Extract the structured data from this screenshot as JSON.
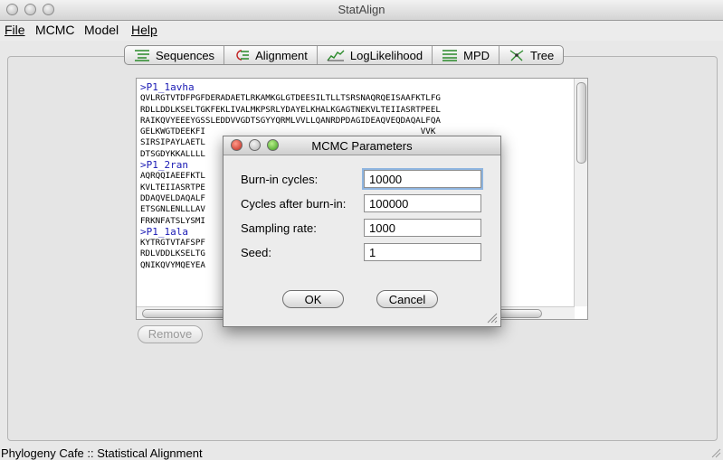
{
  "window": {
    "title": "StatAlign"
  },
  "menu": {
    "file": "File",
    "mcmc": "MCMC",
    "model": "Model",
    "help": "Help"
  },
  "tabs": {
    "sequences": "Sequences",
    "alignment": "Alignment",
    "loglikelihood": "LogLikelihood",
    "mpd": "MPD",
    "tree": "Tree"
  },
  "sequences": {
    "lines": [
      {
        "name": true,
        "text": ">P1_1avha"
      },
      {
        "name": false,
        "text": "QVLRGTVTDFPGFDERADAETLRKAMKGLGTDEESILTLLTSRSNAQRQEISAAFKTLFG"
      },
      {
        "name": false,
        "text": "RDLLDDLKSELTGKFEKLIVALMKPSRLYDAYELKHALKGAGTNEKVLTEIIASRTPEEL"
      },
      {
        "name": false,
        "text": "RAIKQVYEEEYGSSLEDDVVGDTSGYYQRMLVVLLQANRDPDAGIDEAQVEQDAQALFQA"
      },
      {
        "name": false,
        "text": "GELKWGTDEEKFI                                           VVK"
      },
      {
        "name": false,
        "text": "SIRSIPAYLAETL                                           HIKG"
      },
      {
        "name": false,
        "text": "DTSGDYKKALLLL"
      },
      {
        "name": true,
        "text": ">P1_2ran"
      },
      {
        "name": false,
        "text": "AQRQQIAEEFKTL                                           TDE"
      },
      {
        "name": false,
        "text": "KVLTEIIASRTPE                                           TAI"
      },
      {
        "name": false,
        "text": "DDAQVELDAQALF                                           IDR"
      },
      {
        "name": false,
        "text": "ETSGNLENLLLAV                                           RKE"
      },
      {
        "name": false,
        "text": "FRKNFATSLYSMI"
      },
      {
        "name": true,
        "text": ">P1_1ala"
      },
      {
        "name": false,
        "text": "KYTRGTVTAFSPF                                           LFG"
      },
      {
        "name": false,
        "text": "RDLVDDLKSELTG                                           AEV"
      },
      {
        "name": false,
        "text": "QNIKQVYMQEYEA                                           FRA"
      }
    ]
  },
  "remove_button": "Remove",
  "status_bar": "Phylogeny Cafe :: Statistical Alignment",
  "dialog": {
    "title": "MCMC Parameters",
    "fields": [
      {
        "label": "Burn-in cycles:",
        "value": "10000"
      },
      {
        "label": "Cycles after burn-in:",
        "value": "100000"
      },
      {
        "label": "Sampling rate:",
        "value": "1000"
      },
      {
        "label": "Seed:",
        "value": "1"
      }
    ],
    "ok": "OK",
    "cancel": "Cancel"
  }
}
